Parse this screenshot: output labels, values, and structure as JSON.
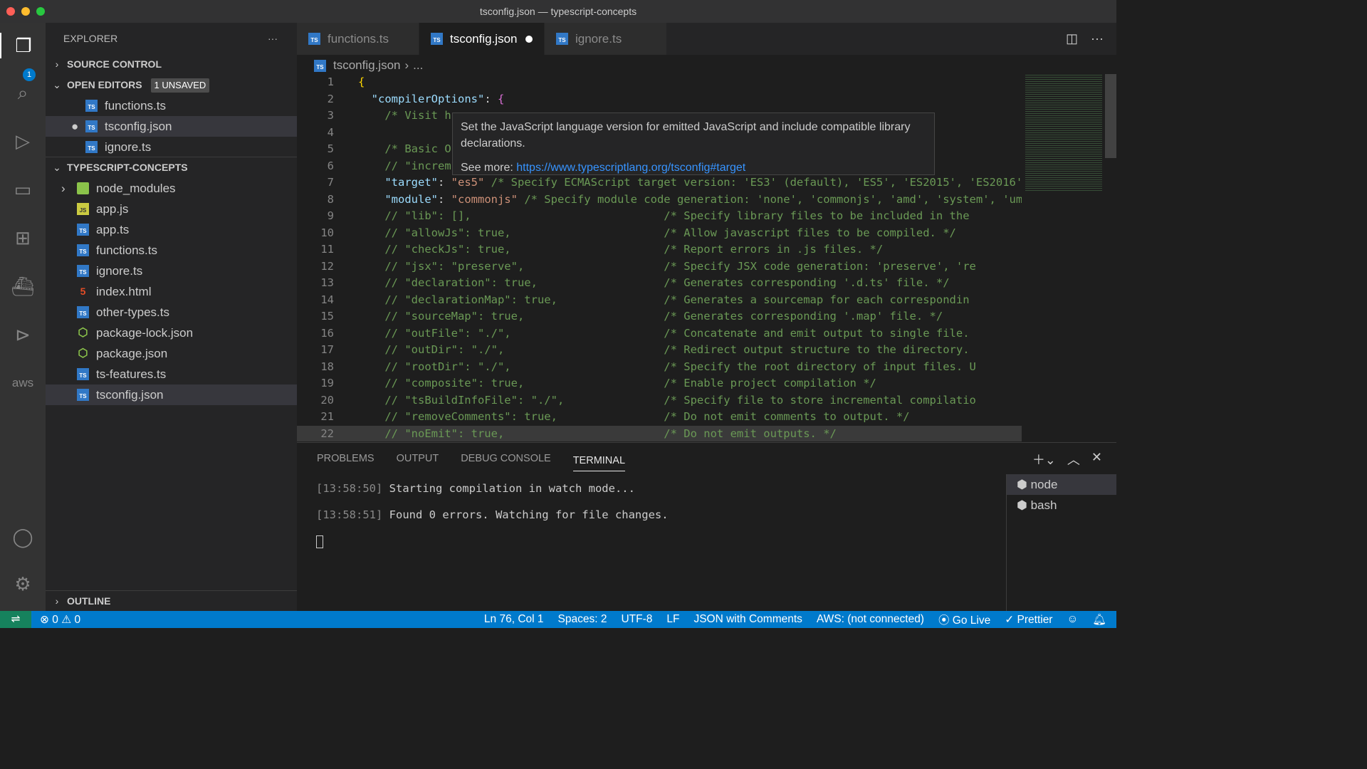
{
  "window": {
    "title": "tsconfig.json — typescript-concepts"
  },
  "activity": {
    "explorer_badge": "1",
    "items": [
      "files-icon",
      "search-icon",
      "run-debug-icon",
      "remote-explorer-icon",
      "extensions-icon",
      "docker-icon",
      "terminal-icon",
      "aws-icon",
      "account-icon",
      "gear-icon"
    ],
    "aws_label": "aws"
  },
  "sidebar": {
    "title": "EXPLORER",
    "more": "···",
    "source_control": "SOURCE CONTROL",
    "open_editors": {
      "label": "OPEN EDITORS",
      "badge": "1 UNSAVED",
      "items": [
        {
          "name": "functions.ts",
          "icon": "TS"
        },
        {
          "name": "tsconfig.json",
          "icon": "TS",
          "dirty": true
        },
        {
          "name": "ignore.ts",
          "icon": "TS"
        }
      ]
    },
    "project": {
      "label": "TYPESCRIPT-CONCEPTS",
      "items": [
        {
          "name": "node_modules",
          "type": "folder"
        },
        {
          "name": "app.js",
          "type": "js",
          "icon": "JS"
        },
        {
          "name": "app.ts",
          "type": "ts",
          "icon": "TS"
        },
        {
          "name": "functions.ts",
          "type": "ts",
          "icon": "TS"
        },
        {
          "name": "ignore.ts",
          "type": "ts",
          "icon": "TS"
        },
        {
          "name": "index.html",
          "type": "html",
          "icon": "5"
        },
        {
          "name": "other-types.ts",
          "type": "ts",
          "icon": "TS"
        },
        {
          "name": "package-lock.json",
          "type": "npm",
          "icon": "⬡"
        },
        {
          "name": "package.json",
          "type": "npm",
          "icon": "⬡"
        },
        {
          "name": "ts-features.ts",
          "type": "ts",
          "icon": "TS"
        },
        {
          "name": "tsconfig.json",
          "type": "ts",
          "icon": "TS",
          "selected": true
        }
      ]
    },
    "outline": "OUTLINE"
  },
  "tabs": [
    {
      "label": "functions.ts",
      "icon": "TS"
    },
    {
      "label": "tsconfig.json",
      "icon": "TS",
      "active": true
    },
    {
      "label": "ignore.ts",
      "icon": "TS"
    }
  ],
  "breadcrumb": {
    "file": "tsconfig.json",
    "sep": "›",
    "rest": "..."
  },
  "editor": {
    "lines": [
      [
        [
          "b1",
          "{"
        ]
      ],
      [
        [
          "p",
          "  "
        ],
        [
          "k",
          "\"compilerOptions\""
        ],
        [
          "p",
          ": "
        ],
        [
          "b2",
          "{"
        ]
      ],
      [
        [
          "c",
          "    /* Visit h"
        ]
      ],
      [],
      [
        [
          "c",
          "    /* Basic O"
        ]
      ],
      [
        [
          "c",
          "    // \"increm"
        ],
        [
          "c",
          "                                                               */"
        ]
      ],
      [
        [
          "p",
          "    "
        ],
        [
          "k",
          "\"target\""
        ],
        [
          "p",
          ": "
        ],
        [
          "s",
          "\"es5\""
        ],
        [
          "c",
          " /* Specify ECMAScript target version: 'ES3' (default), 'ES5', 'ES2015', 'ES2016'"
        ]
      ],
      [
        [
          "p",
          "    "
        ],
        [
          "k",
          "\"module\""
        ],
        [
          "p",
          ": "
        ],
        [
          "s",
          "\"commonjs\""
        ],
        [
          "c",
          " /* Specify module code generation: 'none', 'commonjs', 'amd', 'system', 'umd'"
        ]
      ],
      [
        [
          "c",
          "    // \"lib\": [],                             /* Specify library files to be included in the"
        ]
      ],
      [
        [
          "c",
          "    // \"allowJs\": true,                       /* Allow javascript files to be compiled. */"
        ]
      ],
      [
        [
          "c",
          "    // \"checkJs\": true,                       /* Report errors in .js files. */"
        ]
      ],
      [
        [
          "c",
          "    // \"jsx\": \"preserve\",                     /* Specify JSX code generation: 'preserve', 're"
        ]
      ],
      [
        [
          "c",
          "    // \"declaration\": true,                   /* Generates corresponding '.d.ts' file. */"
        ]
      ],
      [
        [
          "c",
          "    // \"declarationMap\": true,                /* Generates a sourcemap for each correspondin"
        ]
      ],
      [
        [
          "c",
          "    // \"sourceMap\": true,                     /* Generates corresponding '.map' file. */"
        ]
      ],
      [
        [
          "c",
          "    // \"outFile\": \"./\",                       /* Concatenate and emit output to single file."
        ]
      ],
      [
        [
          "c",
          "    // \"outDir\": \"./\",                        /* Redirect output structure to the directory."
        ]
      ],
      [
        [
          "c",
          "    // \"rootDir\": \"./\",                       /* Specify the root directory of input files. U"
        ]
      ],
      [
        [
          "c",
          "    // \"composite\": true,                     /* Enable project compilation */"
        ]
      ],
      [
        [
          "c",
          "    // \"tsBuildInfoFile\": \"./\",               /* Specify file to store incremental compilatio"
        ]
      ],
      [
        [
          "c",
          "    // \"removeComments\": true,                /* Do not emit comments to output. */"
        ]
      ],
      [
        [
          "c",
          "    // \"noEmit\": true,                        /* Do not emit outputs. */"
        ]
      ]
    ]
  },
  "hover": {
    "text": "Set the JavaScript language version for emitted JavaScript and include compatible library declarations.",
    "see_more": "See more: ",
    "link": "https://www.typescriptlang.org/tsconfig#target"
  },
  "panel": {
    "tabs": [
      "PROBLEMS",
      "OUTPUT",
      "DEBUG CONSOLE",
      "TERMINAL"
    ],
    "active": "TERMINAL",
    "terminal": [
      {
        "time": "[13:58:50]",
        "text": " Starting compilation in watch mode..."
      },
      {
        "time": "[13:58:51]",
        "text": " Found 0 errors. Watching for file changes."
      }
    ],
    "terminals": [
      "node",
      "bash"
    ]
  },
  "status": {
    "errors": "0",
    "warnings": "0",
    "position": "Ln 76, Col 1",
    "spaces": "Spaces: 2",
    "encoding": "UTF-8",
    "eol": "LF",
    "language": "JSON with Comments",
    "aws": "AWS: (not connected)",
    "golive": "Go Live",
    "prettier": "✓ Prettier"
  },
  "colors": {
    "accent": "#007acc",
    "remote": "#16825d",
    "link": "#3794ff"
  }
}
